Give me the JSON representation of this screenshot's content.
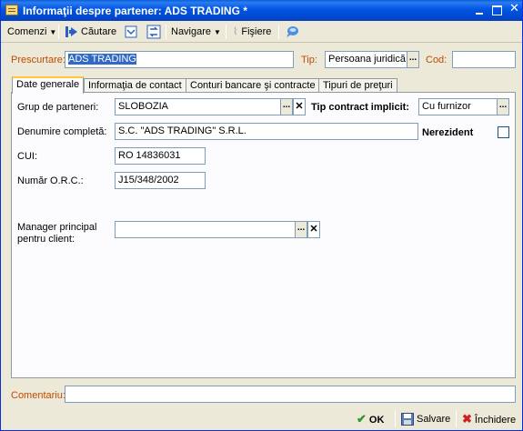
{
  "window": {
    "title": "Informaţii despre partener: ADS TRADING *"
  },
  "toolbar": {
    "comenzi": "Comenzi",
    "cautare": "Căutare",
    "navigare": "Navigare",
    "fisiere": "Fişiere"
  },
  "header": {
    "prescurtare_label": "Prescurtare:",
    "prescurtare_value": "ADS TRADING",
    "tip_label": "Tip:",
    "tip_value": "Persoana juridică",
    "cod_label": "Cod:",
    "cod_value": ""
  },
  "tabs": [
    {
      "label": "Date generale",
      "active": true
    },
    {
      "label": "Informaţia de contact",
      "active": false
    },
    {
      "label": "Conturi bancare şi contracte",
      "active": false
    },
    {
      "label": "Tipuri de preţuri",
      "active": false
    }
  ],
  "general": {
    "grup_label": "Grup de parteneri:",
    "grup_value": "SLOBOZIA",
    "tip_contract_label": "Tip contract implicit:",
    "tip_contract_value": "Cu furnizor",
    "denumire_label": "Denumire completă:",
    "denumire_value": "S.C. \"ADS TRADING\" S.R.L.",
    "nerezident_label": "Nerezident",
    "nerezident_checked": false,
    "cui_label": "CUI:",
    "cui_value": "RO 14836031",
    "orc_label": "Număr O.R.C.:",
    "orc_value": "J15/348/2002",
    "manager_label_1": "Manager principal",
    "manager_label_2": "pentru client:",
    "manager_value": ""
  },
  "footer": {
    "comentariu_label": "Comentariu:",
    "comentariu_value": "",
    "ok": "OK",
    "salvare": "Salvare",
    "inchidere": "Închidere"
  },
  "colors": {
    "titlebar": "#0054e3",
    "label_orange": "#c04a00",
    "selection": "#316ac5",
    "tab_highlight": "#ffc83c"
  }
}
